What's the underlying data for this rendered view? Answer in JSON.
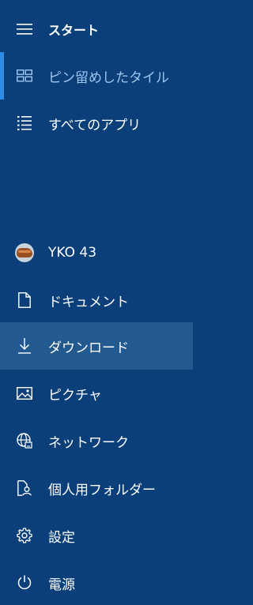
{
  "menu": {
    "header": {
      "label": "スタート",
      "icon": "hamburger-icon"
    },
    "items": [
      {
        "label": "ピン留めしたタイル",
        "icon": "tiles-icon",
        "selected": true
      },
      {
        "label": "すべてのアプリ",
        "icon": "list-icon"
      },
      {
        "label": "YKO 43",
        "icon": "avatar"
      },
      {
        "label": "ドキュメント",
        "icon": "document-icon"
      },
      {
        "label": "ダウンロード",
        "icon": "download-icon",
        "hover": true
      },
      {
        "label": "ピクチャ",
        "icon": "picture-icon"
      },
      {
        "label": "ネットワーク",
        "icon": "network-icon"
      },
      {
        "label": "個人用フォルダー",
        "icon": "user-folder-icon"
      },
      {
        "label": "設定",
        "icon": "gear-icon"
      },
      {
        "label": "電源",
        "icon": "power-icon"
      }
    ]
  },
  "colors": {
    "background": "#0a3f7a",
    "accent": "#2d8ce3",
    "selected_text": "#9ec6f0",
    "hover_background": "#225a8f"
  }
}
